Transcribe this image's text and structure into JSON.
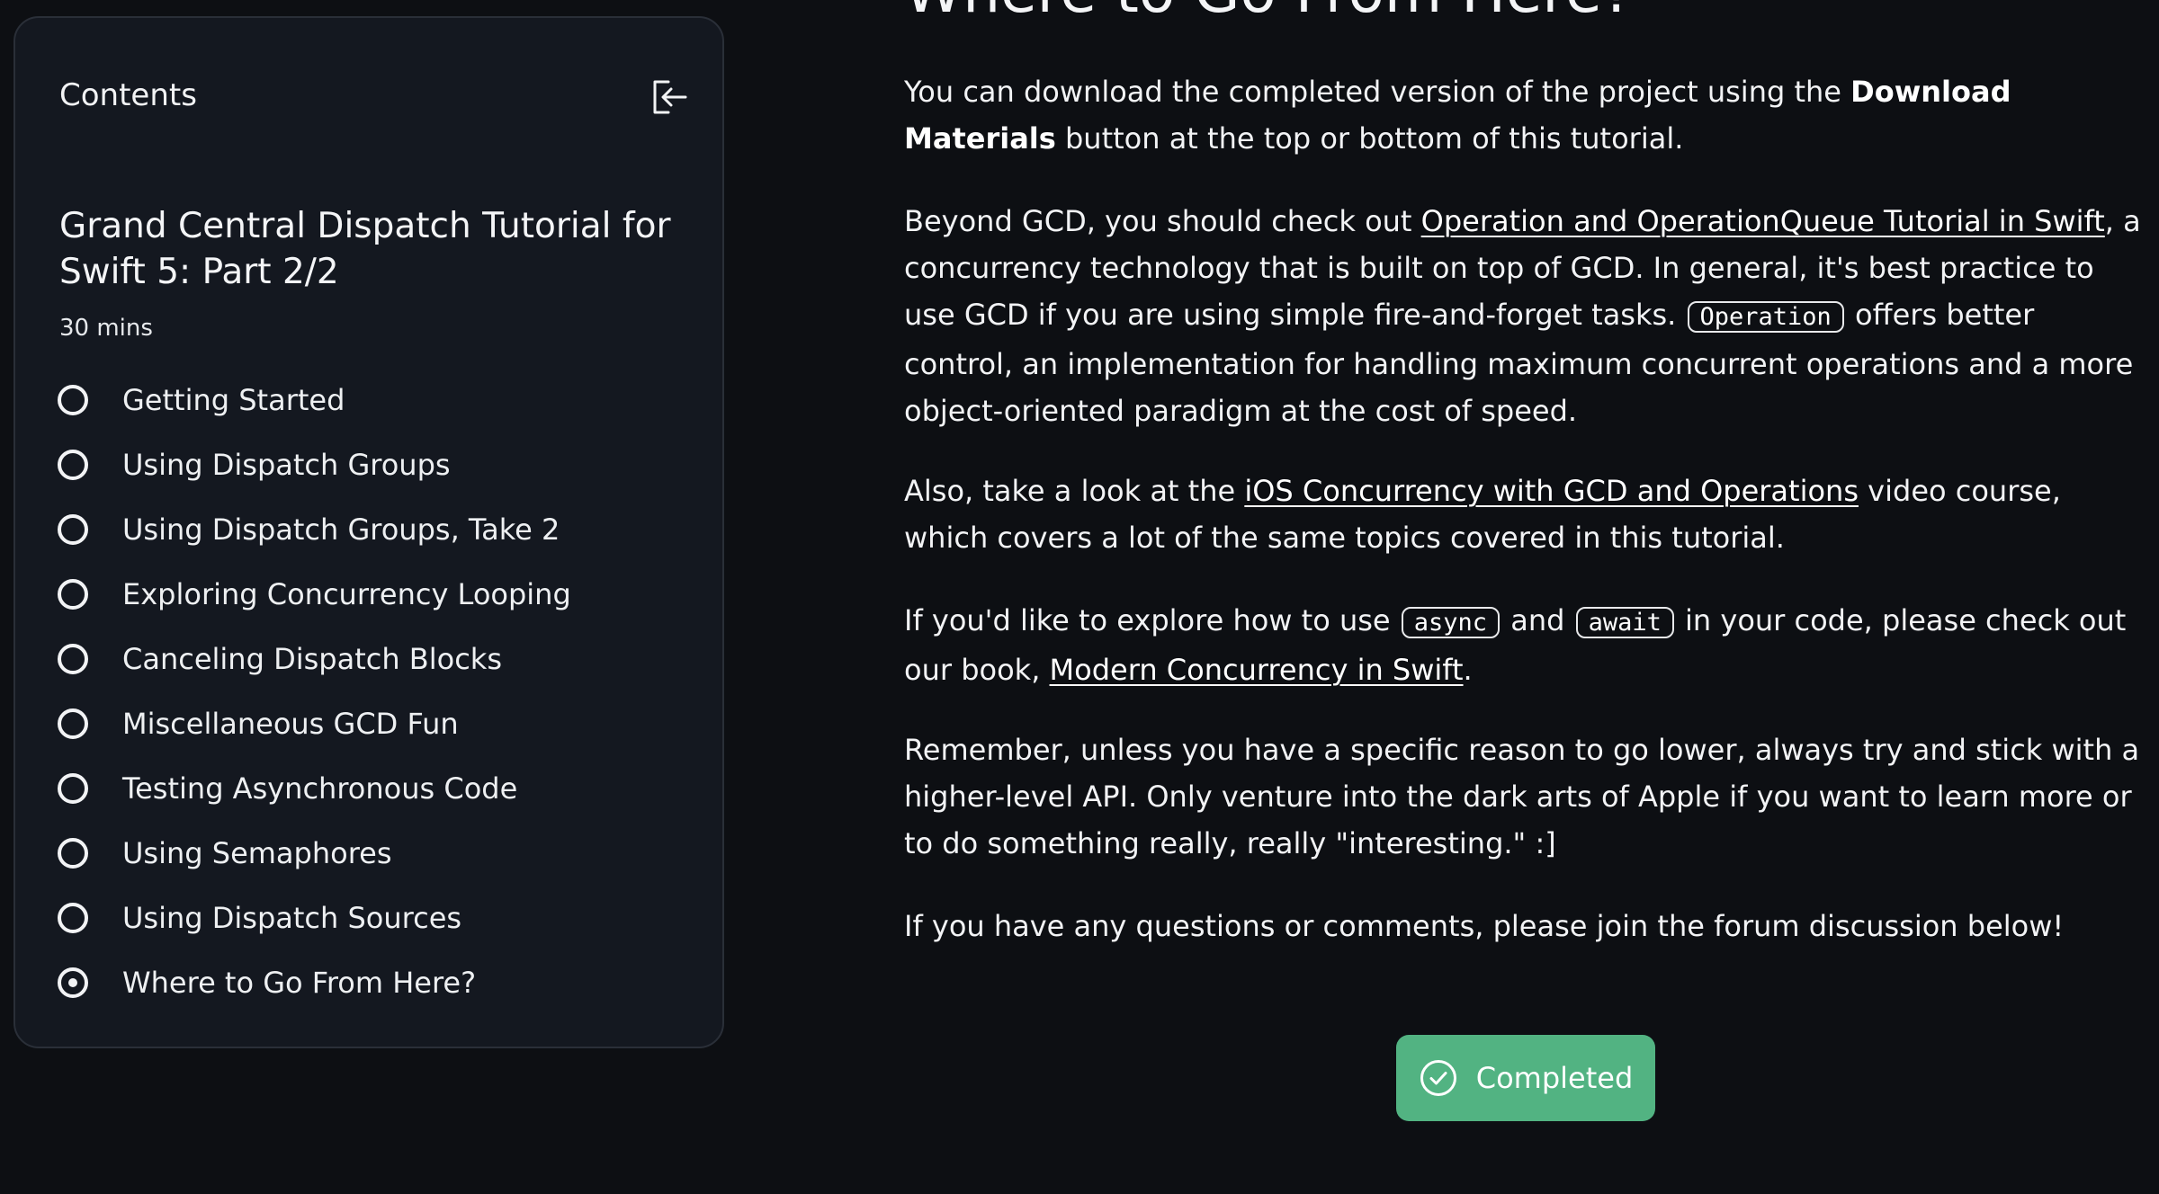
{
  "sidebar": {
    "header": "Contents",
    "collapse_icon": "collapse-left-icon",
    "tutorial_title": "Grand Central Dispatch Tutorial for Swift 5: Part 2/2",
    "duration": "30 mins",
    "items": [
      {
        "label": "Getting Started",
        "current": false
      },
      {
        "label": "Using Dispatch Groups",
        "current": false
      },
      {
        "label": "Using Dispatch Groups, Take 2",
        "current": false
      },
      {
        "label": "Exploring Concurrency Looping",
        "current": false
      },
      {
        "label": "Canceling Dispatch Blocks",
        "current": false
      },
      {
        "label": "Miscellaneous GCD Fun",
        "current": false
      },
      {
        "label": "Testing Asynchronous Code",
        "current": false
      },
      {
        "label": "Using Semaphores",
        "current": false
      },
      {
        "label": "Using Dispatch Sources",
        "current": false
      },
      {
        "label": "Where to Go From Here?",
        "current": true
      }
    ]
  },
  "article": {
    "heading": "Where to Go From Here?",
    "p1": {
      "t1": "You can download the completed version of the project using the ",
      "bold": "Download Materials",
      "t2": " button at the top or bottom of this tutorial."
    },
    "p2": {
      "t1": "Beyond GCD, you should check out ",
      "link": "Operation and OperationQueue Tutorial in Swift",
      "t2": ", a concurrency technology that is built on top of GCD. In general, it's best practice to use GCD if you are using simple fire-and-forget tasks. ",
      "code": "Operation",
      "t3": " offers better control, an implementation for handling maximum concurrent operations and a more object-oriented paradigm at the cost of speed."
    },
    "p3": {
      "t1": "Also, take a look at the ",
      "link": "iOS Concurrency with GCD and Operations",
      "t2": " video course, which covers a lot of the same topics covered in this tutorial."
    },
    "p4": {
      "t1": "If you'd like to explore how to use ",
      "code1": "async",
      "t2": " and ",
      "code2": "await",
      "t3": " in your code, please check out our book, ",
      "link": "Modern Concurrency in Swift",
      "t4": "."
    },
    "p5": "Remember, unless you have a specific reason to go lower, always try and stick with a higher-level API. Only venture into the dark arts of Apple if you want to learn more or to do something really, really \"interesting.\" :]",
    "p6": "If you have any questions or comments, please join the forum discussion below!"
  },
  "completed_button": {
    "label": "Completed",
    "icon": "check-circle-icon",
    "color": "#52b382"
  }
}
